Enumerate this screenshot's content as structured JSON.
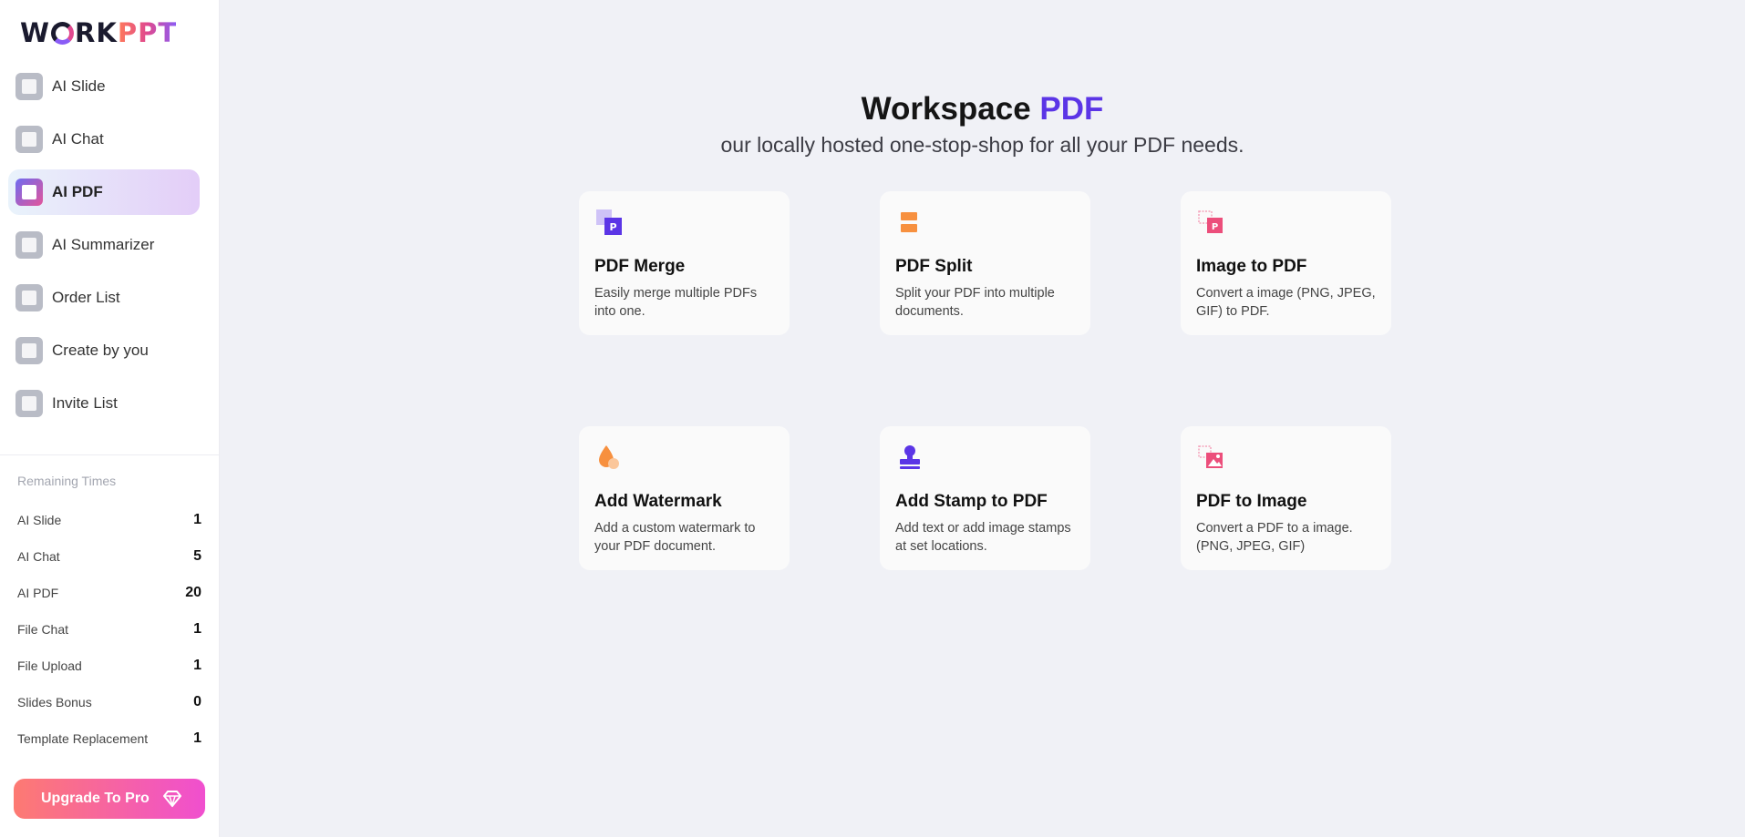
{
  "logo": {
    "prefix": "W",
    "middle": "RK",
    "accent": "PPT"
  },
  "sidebar": {
    "items": [
      {
        "label": "AI Slide",
        "icon": "slide-icon"
      },
      {
        "label": "AI Chat",
        "icon": "chat-icon"
      },
      {
        "label": "AI PDF",
        "icon": "pdf-icon",
        "active": true
      },
      {
        "label": "AI Summarizer",
        "icon": "summarizer-icon"
      },
      {
        "label": "Order List",
        "icon": "order-list-icon"
      },
      {
        "label": "Create by you",
        "icon": "create-icon"
      },
      {
        "label": "Invite List",
        "icon": "invite-icon"
      }
    ]
  },
  "remaining": {
    "title": "Remaining Times",
    "rows": [
      {
        "label": "AI Slide",
        "value": "1"
      },
      {
        "label": "AI Chat",
        "value": "5"
      },
      {
        "label": "AI PDF",
        "value": "20"
      },
      {
        "label": "File Chat",
        "value": "1"
      },
      {
        "label": "File Upload",
        "value": "1"
      },
      {
        "label": "Slides Bonus",
        "value": "0"
      },
      {
        "label": "Template Replacement",
        "value": "1"
      }
    ]
  },
  "upgrade": {
    "label": "Upgrade To Pro"
  },
  "main": {
    "title": "Workspace",
    "title_accent": "PDF",
    "subtitle": "our locally hosted one-stop-shop for all your PDF needs.",
    "cards": [
      {
        "title": "PDF Merge",
        "desc": "Easily merge multiple PDFs into one.",
        "icon": "merge-icon"
      },
      {
        "title": "PDF Split",
        "desc": "Split your PDF into multiple documents.",
        "icon": "split-icon"
      },
      {
        "title": "Image to PDF",
        "desc": "Convert a image (PNG, JPEG, GIF) to PDF.",
        "icon": "image-to-pdf-icon"
      },
      {
        "title": "Add Watermark",
        "desc": "Add a custom watermark to your PDF document.",
        "icon": "watermark-icon"
      },
      {
        "title": "Add Stamp to PDF",
        "desc": "Add text or add image stamps at set locations.",
        "icon": "stamp-icon"
      },
      {
        "title": "PDF to Image",
        "desc": "Convert a PDF to a image. (PNG, JPEG, GIF)",
        "icon": "pdf-to-image-icon"
      }
    ]
  },
  "colors": {
    "accent": "#5b35e6",
    "upgrade_start": "#fd7a72",
    "upgrade_end": "#f04fcf",
    "orange": "#f7903f",
    "pink": "#ec4e7b"
  }
}
